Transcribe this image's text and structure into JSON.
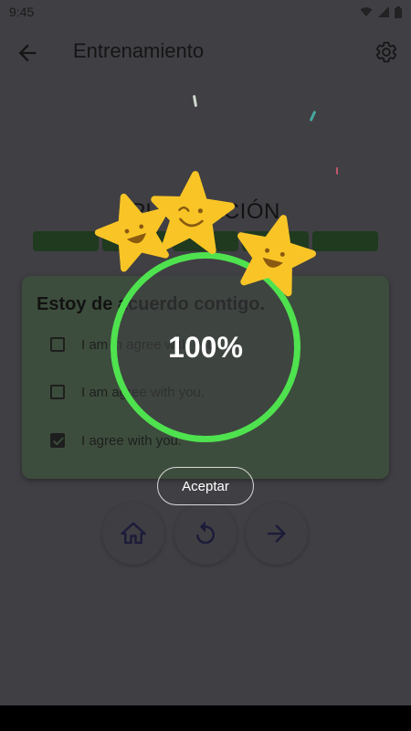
{
  "status_bar": {
    "time": "9:45"
  },
  "app_bar": {
    "title": "Entrenamiento"
  },
  "background": {
    "heading": "PUNTUACIÓN",
    "progress_segments": 5,
    "card": {
      "question": "Estoy de acuerdo contigo.",
      "options": [
        {
          "text": "I am in agree with you.",
          "checked": false
        },
        {
          "text": "I am agree with you.",
          "checked": false
        },
        {
          "text": "I agree with you.",
          "checked": true
        }
      ]
    },
    "nav_buttons": [
      "home-icon",
      "replay-icon",
      "arrow-forward-icon"
    ]
  },
  "result_dialog": {
    "percent": "100%",
    "progress": 1.0,
    "stars": 3,
    "accept_label": "Aceptar",
    "ring_color": "#4fe24f",
    "star_color": "#f9c526"
  }
}
